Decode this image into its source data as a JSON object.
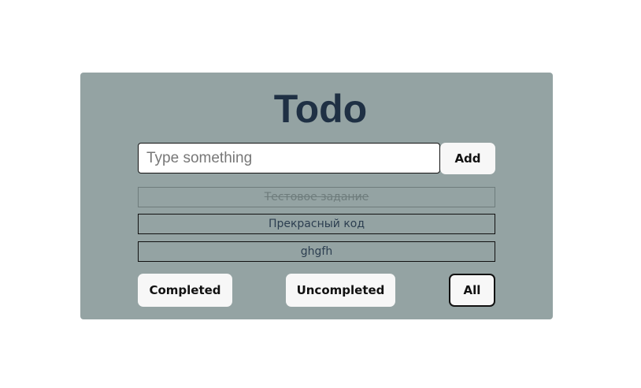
{
  "app": {
    "title": "Todo"
  },
  "input": {
    "placeholder": "Type something",
    "value": ""
  },
  "buttons": {
    "add_label": "Add"
  },
  "todos": [
    {
      "text": "Тестовое задание",
      "completed": true
    },
    {
      "text": "Прекрасный код",
      "completed": false
    },
    {
      "text": "ghgfh",
      "completed": false
    }
  ],
  "filters": {
    "completed_label": "Completed",
    "uncompleted_label": "Uncompleted",
    "all_label": "All",
    "active": "All"
  },
  "colors": {
    "card_background": "#94a3a3",
    "title": "#1f3044",
    "button_background": "#f7f7f7"
  }
}
